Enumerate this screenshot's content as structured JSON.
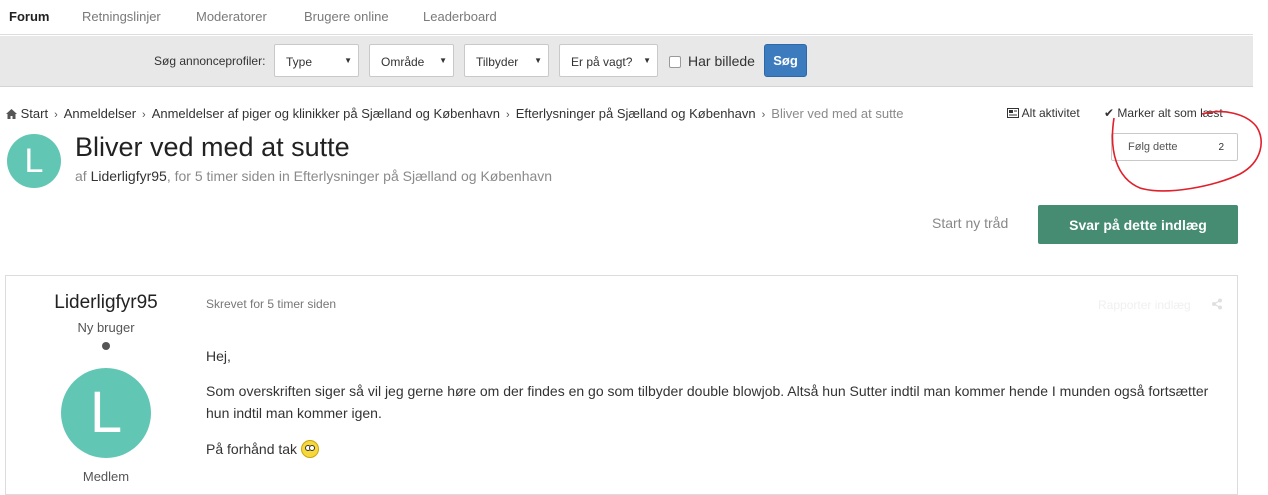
{
  "nav": {
    "items": [
      "Forum",
      "Retningslinjer",
      "Moderatorer",
      "Brugere online",
      "Leaderboard"
    ],
    "active": "Forum"
  },
  "search": {
    "label": "Søg annonceprofiler:",
    "selects": [
      "Type",
      "Område",
      "Tilbyder",
      "Er på vagt?"
    ],
    "checkbox_label": "Har billede",
    "checkbox_checked": false,
    "button": "Søg"
  },
  "breadcrumb": {
    "home_icon": "home-icon",
    "items": [
      "Start",
      "Anmeldelser",
      "Anmeldelser af piger og klinikker på Sjælland og København",
      "Efterlysninger på Sjælland og København",
      "Bliver ved med at sutte"
    ]
  },
  "actions": {
    "all_activity": "Alt aktivitet",
    "mark_read": "Marker alt som læst"
  },
  "follow": {
    "label": "Følg dette",
    "count": "2"
  },
  "thread": {
    "avatar_letter": "L",
    "title": "Bliver ved med at sutte",
    "by": "af ",
    "author": "Liderligfyr95",
    "meta": ", for 5 timer siden in Efterlysninger på Sjælland og København"
  },
  "buttons": {
    "new_thread": "Start ny tråd",
    "reply": "Svar på dette indlæg"
  },
  "post": {
    "author": "Liderligfyr95",
    "rank": "Ny bruger",
    "avatar_letter": "L",
    "group": "Medlem",
    "date": "Skrevet for 5 timer siden",
    "report": "Rapporter indlæg",
    "paragraphs": [
      "Hej,",
      "Som overskriften siger så vil jeg gerne høre om der findes en go som tilbyder double blowjob. Altså hun Sutter indtil man kommer hende I munden også fortsætter hun indtil man kommer igen.",
      "På forhånd tak"
    ]
  },
  "colors": {
    "accent_teal": "#62c6b5",
    "reply_green": "#458c73",
    "search_blue": "#3d7bbf",
    "annotation_red": "#e0202a"
  }
}
